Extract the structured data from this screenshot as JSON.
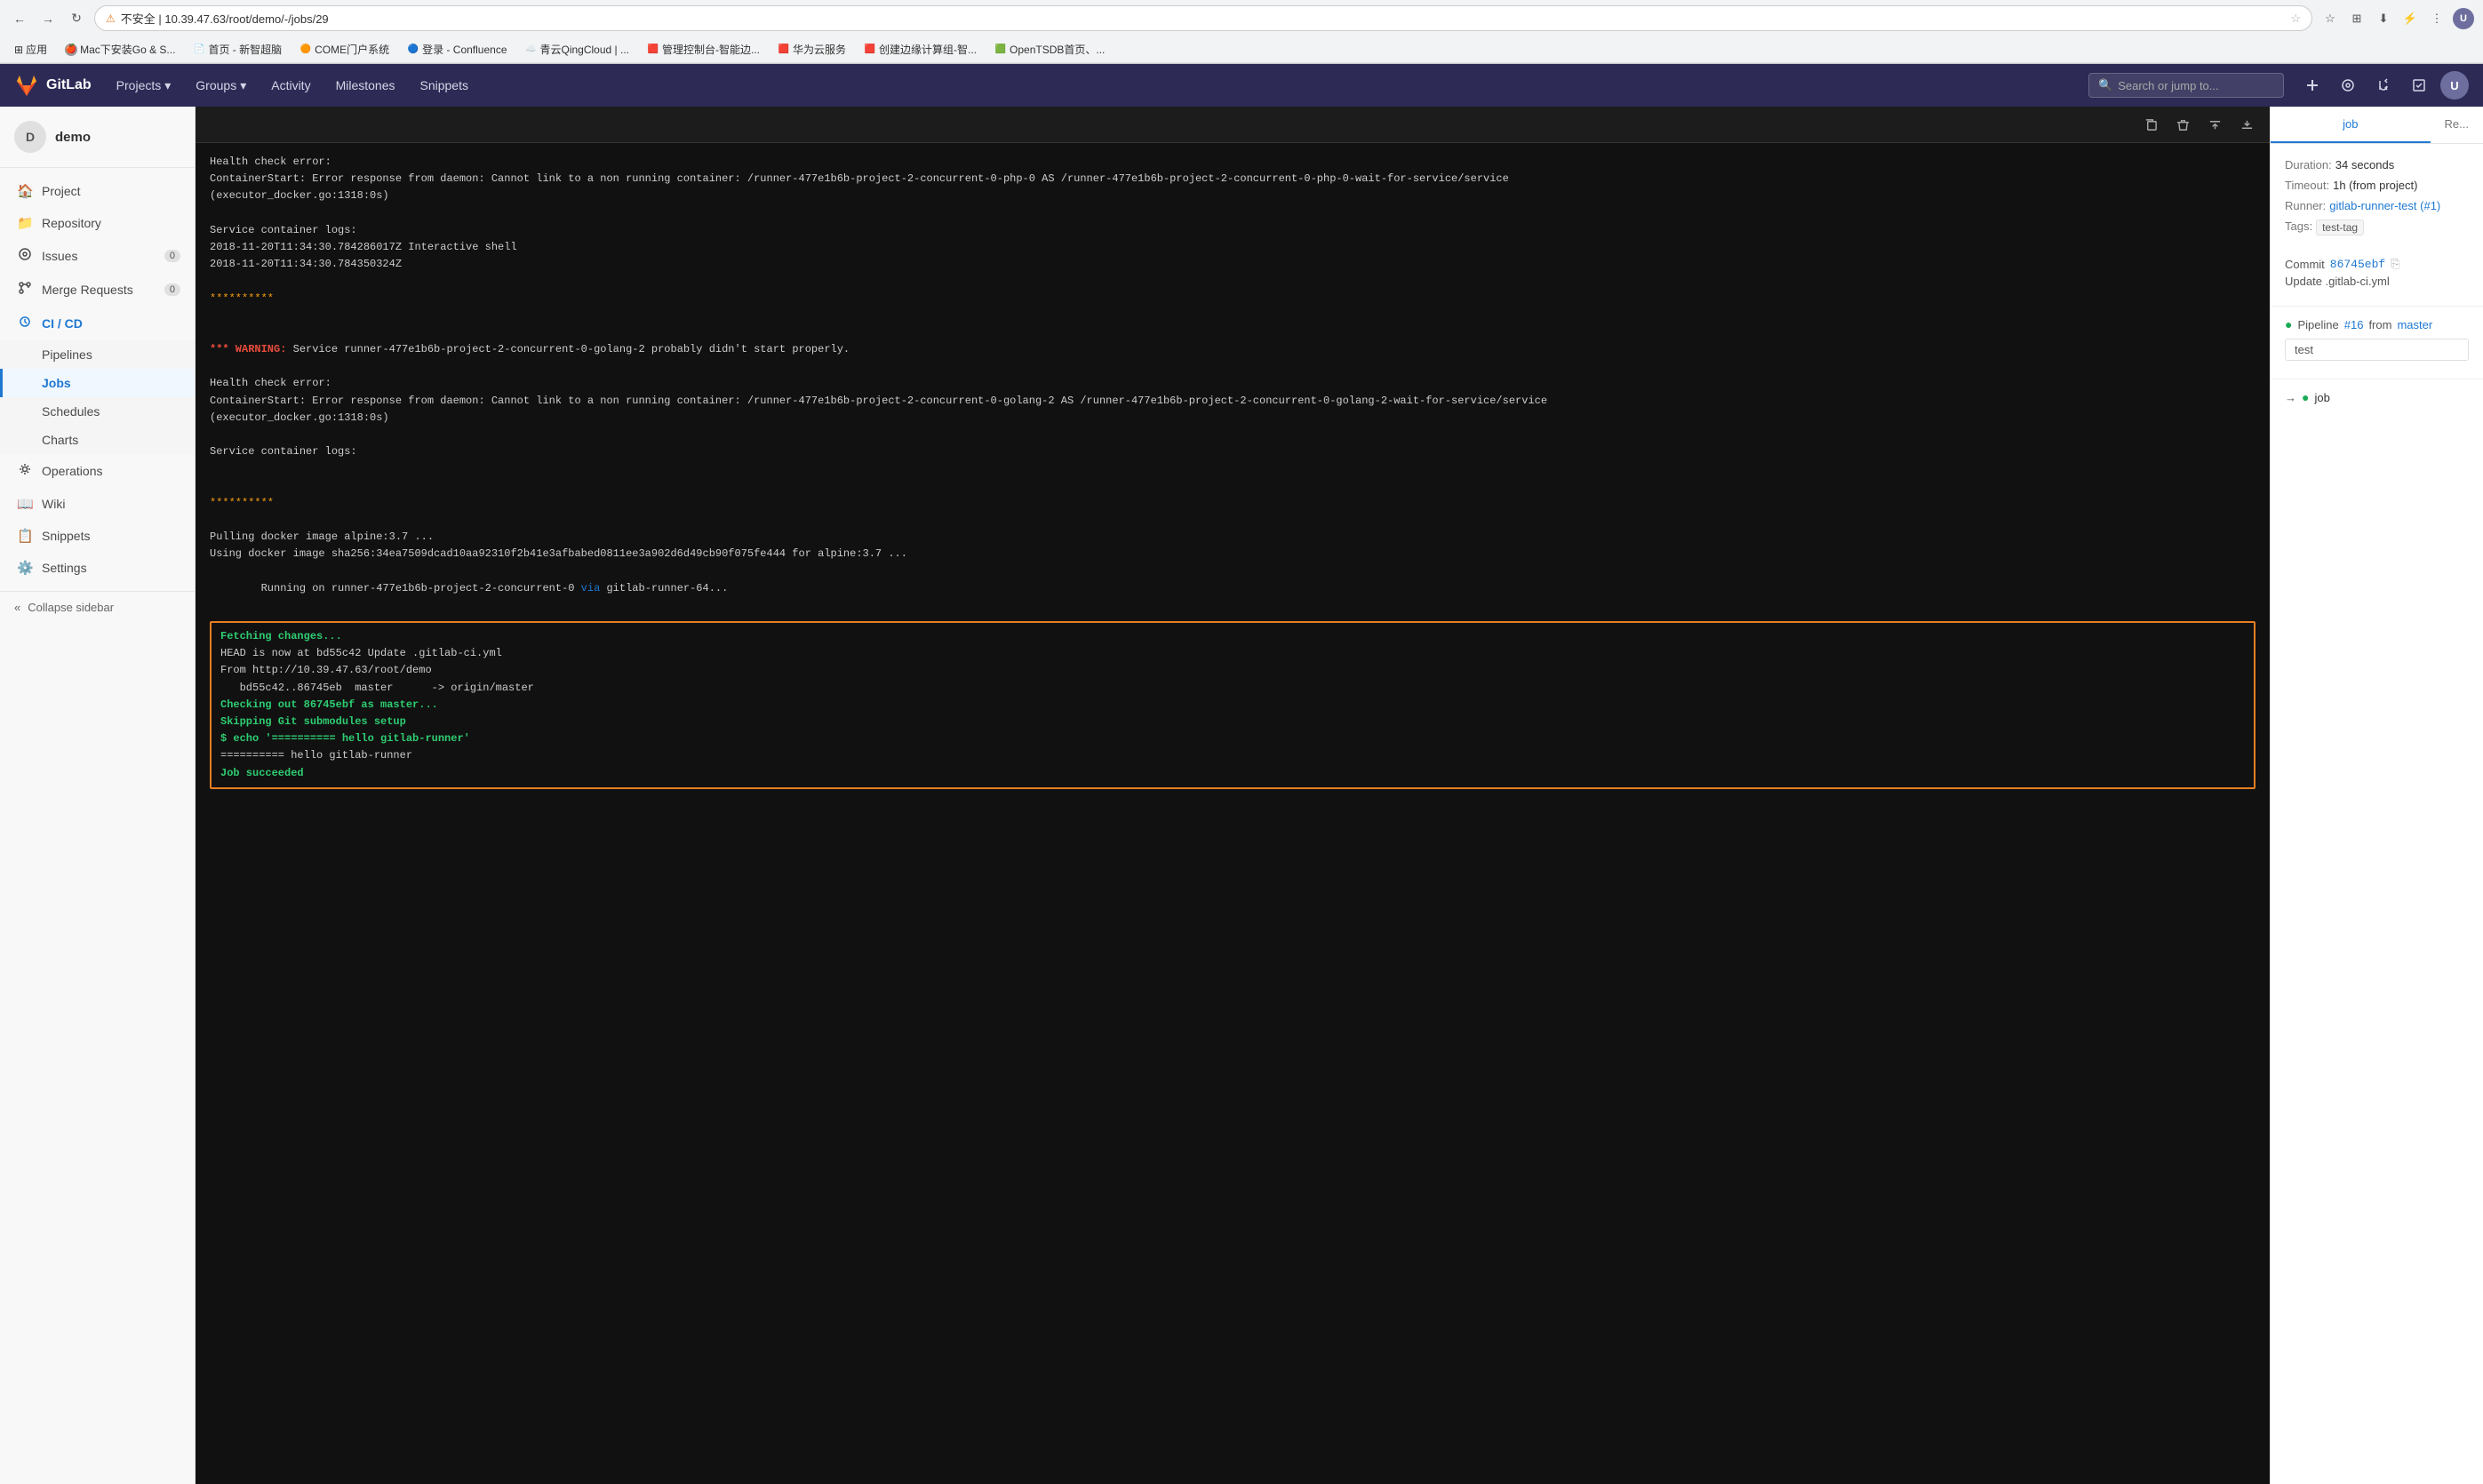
{
  "browser": {
    "url": "10.39.47.63/root/demo/-/jobs/29",
    "url_display": "不安全 | 10.39.47.63/root/demo/-/jobs/29",
    "bookmarks": [
      {
        "label": "应用",
        "icon": "📱"
      },
      {
        "label": "Mac下安装Go & S...",
        "icon": "🍎"
      },
      {
        "label": "首页 - 新智超脑",
        "icon": "📄"
      },
      {
        "label": "COME门户系统",
        "icon": "🟠"
      },
      {
        "label": "登录 - Confluence",
        "icon": "🔵"
      },
      {
        "label": "青云QingCloud | ...",
        "icon": "☁️"
      },
      {
        "label": "管理控制台-智能边...",
        "icon": "🟥"
      },
      {
        "label": "华为云服务",
        "icon": "🟥"
      },
      {
        "label": "创建边缘计算组-智...",
        "icon": "🟥"
      },
      {
        "label": "OpenTSDB首页、...",
        "icon": "🟩"
      }
    ]
  },
  "gitlab_header": {
    "logo_text": "GitLab",
    "nav_items": [
      {
        "label": "Projects",
        "has_dropdown": true
      },
      {
        "label": "Groups",
        "has_dropdown": true
      },
      {
        "label": "Activity"
      },
      {
        "label": "Milestones"
      },
      {
        "label": "Snippets"
      }
    ],
    "search_placeholder": "Search or jump to..."
  },
  "sidebar": {
    "user": {
      "initial": "D",
      "name": "demo"
    },
    "items": [
      {
        "label": "Project",
        "icon": "🏠",
        "key": "project"
      },
      {
        "label": "Repository",
        "icon": "📁",
        "key": "repository"
      },
      {
        "label": "Issues",
        "icon": "⚠️",
        "key": "issues",
        "badge": "0"
      },
      {
        "label": "Merge Requests",
        "icon": "🔀",
        "key": "merge-requests",
        "badge": "0"
      },
      {
        "label": "CI / CD",
        "icon": "⚙️",
        "key": "ci-cd",
        "active": true,
        "sub_items": [
          {
            "label": "Pipelines",
            "key": "pipelines"
          },
          {
            "label": "Jobs",
            "key": "jobs",
            "active": true
          },
          {
            "label": "Schedules",
            "key": "schedules"
          },
          {
            "label": "Charts",
            "key": "charts"
          }
        ]
      },
      {
        "label": "Operations",
        "icon": "🔧",
        "key": "operations"
      },
      {
        "label": "Wiki",
        "icon": "📖",
        "key": "wiki"
      },
      {
        "label": "Snippets",
        "icon": "📋",
        "key": "snippets"
      },
      {
        "label": "Settings",
        "icon": "⚙️",
        "key": "settings"
      }
    ],
    "collapse_label": "Collapse sidebar"
  },
  "log_toolbar": {
    "buttons": [
      "📋",
      "🗑️",
      "⬆️",
      "⬇️"
    ]
  },
  "log_content": {
    "lines": [
      {
        "text": "Health check error:",
        "class": ""
      },
      {
        "text": "ContainerStart: Error response from daemon: Cannot link to a non running container: /runner-477e1b6b-project-2-concurrent-0-php-0 AS /runner-477e1b6b-project-2-concurrent-0-php-0-wait-for-service/service\n(executor_docker.go:1318:0s)",
        "class": ""
      },
      {
        "text": "",
        "class": ""
      },
      {
        "text": "Service container logs:",
        "class": ""
      },
      {
        "text": "2018-11-20T11:34:30.784286017Z Interactive shell",
        "class": ""
      },
      {
        "text": "2018-11-20T11:34:30.784350324Z",
        "class": ""
      },
      {
        "text": "",
        "class": ""
      },
      {
        "text": "**********",
        "class": "yellow"
      },
      {
        "text": "",
        "class": ""
      },
      {
        "text": "",
        "class": ""
      },
      {
        "text": "*** WARNING: Service runner-477e1b6b-project-2-concurrent-0-golang-2 probably didn't start properly.",
        "class": "warning"
      },
      {
        "text": "",
        "class": ""
      },
      {
        "text": "Health check error:",
        "class": ""
      },
      {
        "text": "ContainerStart: Error response from daemon: Cannot link to a non running container: /runner-477e1b6b-project-2-concurrent-0-golang-2 AS /runner-477e1b6b-project-2-concurrent-0-golang-2-wait-for-service/service\n(executor_docker.go:1318:0s)",
        "class": ""
      },
      {
        "text": "",
        "class": ""
      },
      {
        "text": "Service container logs:",
        "class": ""
      },
      {
        "text": "",
        "class": ""
      },
      {
        "text": "",
        "class": ""
      },
      {
        "text": "**********",
        "class": "yellow"
      },
      {
        "text": "",
        "class": ""
      },
      {
        "text": "Pulling docker image alpine:3.7 ...",
        "class": ""
      },
      {
        "text": "Using docker image sha256:34ea7509dcad10aa92310f2b41e3afbabed0811ee3a902d6d49cb90f075fe444 for alpine:3.7 ...",
        "class": ""
      },
      {
        "text": "Running on runner-477e1b6b-project-2-concurrent-0 via gitlab-runner-64...",
        "class": ""
      }
    ],
    "highlighted_section": {
      "lines": [
        {
          "text": "Fetching changes...",
          "class": "green"
        },
        {
          "text": "HEAD is now at bd55c42 Update .gitlab-ci.yml",
          "class": ""
        },
        {
          "text": "From http://10.39.47.63/root/demo",
          "class": ""
        },
        {
          "text": "   bd55c42..86745eb  master      -> origin/master",
          "class": ""
        },
        {
          "text": "Checking out 86745ebf as master...",
          "class": "green"
        },
        {
          "text": "Skipping Git submodules setup",
          "class": "green"
        },
        {
          "text": "$ echo '========== hello gitlab-runner'",
          "class": "green"
        },
        {
          "text": "========== hello gitlab-runner",
          "class": ""
        },
        {
          "text": "Job succeeded",
          "class": "green"
        }
      ]
    }
  },
  "right_sidebar": {
    "tab_label": "job",
    "retry_label": "Re...",
    "job_info": {
      "duration_label": "Duration:",
      "duration_value": "34 seconds",
      "timeout_label": "Timeout:",
      "timeout_value": "1h (from project)",
      "runner_label": "Runner:",
      "runner_value": "gitlab-runner-test (#1)",
      "tags_label": "Tags:",
      "tags_value": "test-tag"
    },
    "commit": {
      "label": "Commit",
      "hash": "86745ebf",
      "message": "Update .gitlab-ci.yml"
    },
    "pipeline": {
      "label": "Pipeline",
      "pipeline_link": "#16",
      "from_text": "from",
      "branch": "master",
      "stage_label": "test"
    },
    "job_flow": {
      "items": [
        "job"
      ]
    }
  }
}
